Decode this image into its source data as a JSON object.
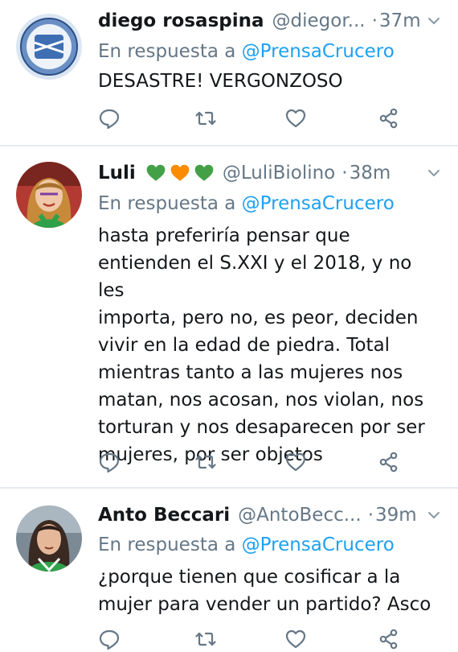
{
  "colors": {
    "muted": "#657786",
    "link": "#1da1f2",
    "text": "#14171a",
    "divider": "#e6ecf0",
    "heart_green": "#43a047",
    "heart_orange": "#fb8c00"
  },
  "icons": [
    "reply-icon",
    "retweet-icon",
    "like-icon",
    "share-icon",
    "chevron-down-icon"
  ],
  "tweets": [
    {
      "name": "diego rosaspina",
      "handle": "@diegor...",
      "separator": "·",
      "time": "37m",
      "reply_prefix": "En respuesta a",
      "reply_mention": "@PrensaCrucero",
      "text": "DESASTRE! VERGONZOSO"
    },
    {
      "name": "Luli",
      "handle": "@LuliBiolino",
      "separator": "·",
      "time": "38m",
      "name_emojis": [
        "green-heart",
        "orange-heart",
        "green-heart"
      ],
      "reply_prefix": "En respuesta a",
      "reply_mention": "@PrensaCrucero",
      "text_lines": [
        "hasta preferiría pensar que",
        "entienden el S.XXI y el 2018, y no les",
        "importa, pero no, es peor, deciden",
        "vivir en la edad de piedra. Total",
        "mientras tanto a las mujeres nos",
        "matan, nos acosan, nos violan, nos",
        "torturan y nos desaparecen por ser",
        "mujeres, por ser objetos"
      ]
    },
    {
      "name": "Anto Beccari",
      "handle": "@AntoBecc...",
      "separator": "·",
      "time": "39m",
      "reply_prefix": "En respuesta a",
      "reply_mention": "@PrensaCrucero",
      "text_lines": [
        "¿porque tienen que cosificar a la",
        "mujer para vender un partido? Asco"
      ]
    }
  ]
}
